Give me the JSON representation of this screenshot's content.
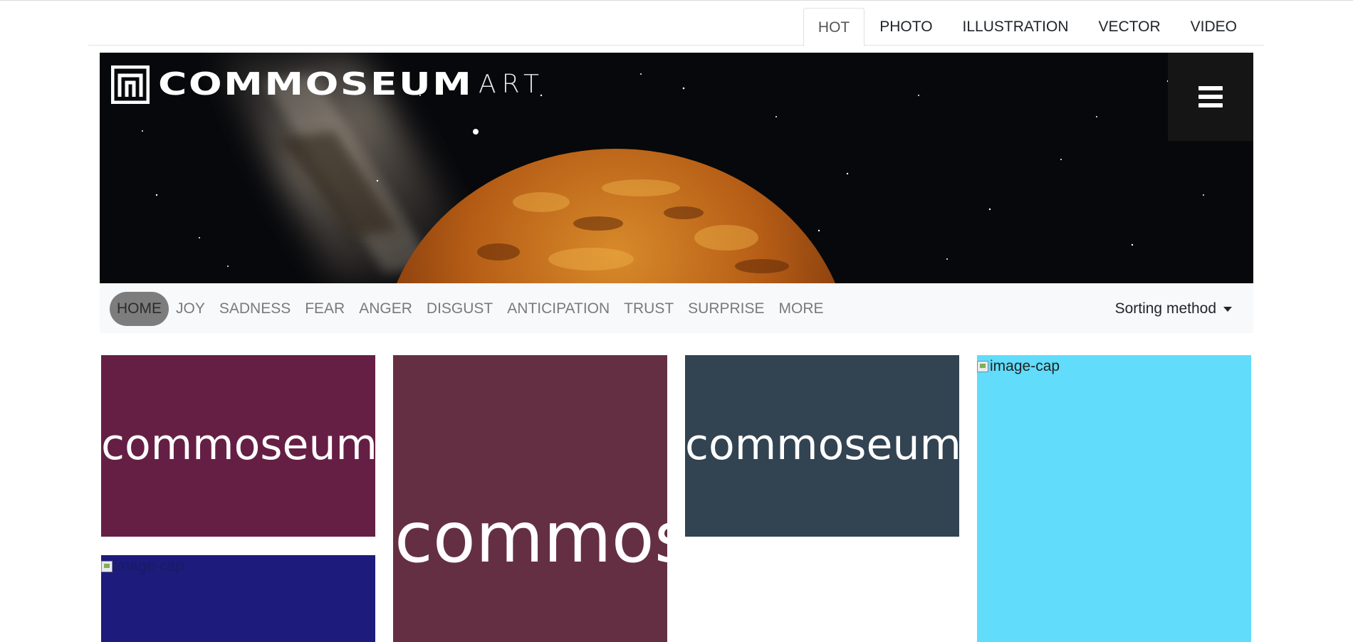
{
  "top_tabs": [
    {
      "label": "HOT",
      "active": true
    },
    {
      "label": "PHOTO",
      "active": false
    },
    {
      "label": "ILLUSTRATION",
      "active": false
    },
    {
      "label": "VECTOR",
      "active": false
    },
    {
      "label": "VIDEO",
      "active": false
    }
  ],
  "brand": {
    "name": "COMMOSEUM",
    "suffix": "ART",
    "logo_icon": "commoseum-logo-icon",
    "menu_icon": "hamburger-menu-icon"
  },
  "categories": [
    {
      "label": "HOME",
      "active": true
    },
    {
      "label": "JOY",
      "active": false
    },
    {
      "label": "SADNESS",
      "active": false
    },
    {
      "label": "FEAR",
      "active": false
    },
    {
      "label": "ANGER",
      "active": false
    },
    {
      "label": "DISGUST",
      "active": false
    },
    {
      "label": "ANTICIPATION",
      "active": false
    },
    {
      "label": "TRUST",
      "active": false
    },
    {
      "label": "SURPRISE",
      "active": false
    },
    {
      "label": "MORE",
      "active": false
    }
  ],
  "sort": {
    "label": "Sorting method"
  },
  "cards": [
    {
      "caption": "commoseum",
      "color": "#661f44"
    },
    {
      "caption": "commoseum",
      "color": "#652f43"
    },
    {
      "caption": "commoseum",
      "color": "#324352"
    },
    {
      "alt": "image-cap",
      "color": "#61dcfb"
    },
    {
      "alt": "image-cap",
      "color": "#1d1b7b"
    }
  ],
  "colors": {
    "nav_bg": "#f8f9fa",
    "active_pill": "#7d7d7d",
    "banner_bg": "#07080b"
  }
}
